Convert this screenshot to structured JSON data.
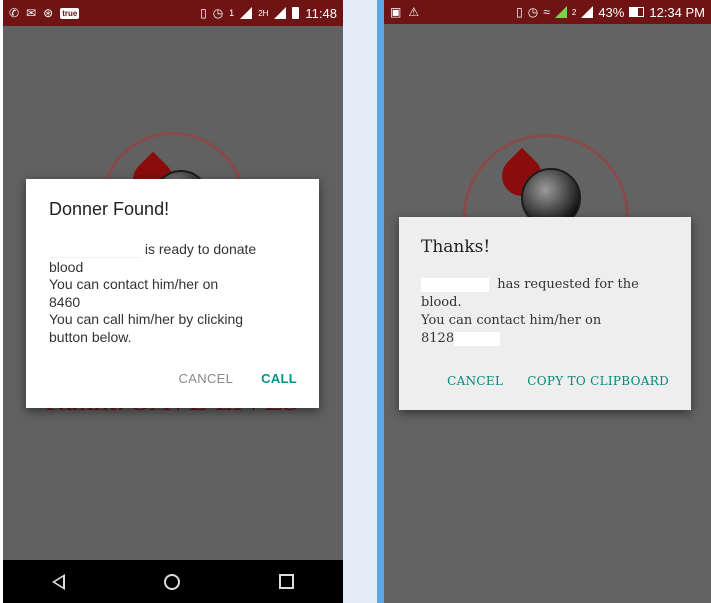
{
  "left_screen": {
    "status_bar": {
      "left_icons": [
        "whatsapp-icon",
        "message-icon",
        "hotspot-icon",
        "truecaller-icon"
      ],
      "truecaller_badge": "true",
      "right_icons": [
        "vibrate-icon",
        "alarm-icon",
        "signal-icon",
        "signal-icon",
        "battery-icon"
      ],
      "sim1_label": "1",
      "sim2_label": "2H",
      "time": "11:48"
    },
    "background": {
      "tagline": "Rakht: SAVE LIVES"
    },
    "dialog": {
      "title": "Donner Found!",
      "line1_suffix": "is ready to donate",
      "line2": "blood",
      "line3": "You can contact him/her on",
      "phone_prefix": "8460",
      "line5": "You can call him/her by clicking",
      "line6": "button below.",
      "cancel_label": "CANCEL",
      "call_label": "CALL"
    },
    "nav_bar": {
      "icons": [
        "back-icon",
        "home-icon",
        "recents-icon"
      ]
    }
  },
  "right_screen": {
    "status_bar": {
      "left_icons": [
        "image-icon",
        "warning-icon"
      ],
      "right_icons": [
        "vibrate-icon",
        "alarm-icon",
        "wifi-icon",
        "signal-icon",
        "signal-icon",
        "battery-icon"
      ],
      "sim_label": "2",
      "battery_percent": "43%",
      "time": "12:34 PM"
    },
    "dialog": {
      "title": "Thanks!",
      "line1_suffix": "has requested for the",
      "line2": "blood.",
      "line3": "You can contact him/her on",
      "phone_prefix": "8128",
      "cancel_label": "CANCEL",
      "copy_label": "COPY TO CLIPBOARD"
    }
  },
  "colors": {
    "status_bar": "#6e1414",
    "accent": "#009688",
    "overlay": "#616161",
    "divider": "#5aa7e8"
  }
}
